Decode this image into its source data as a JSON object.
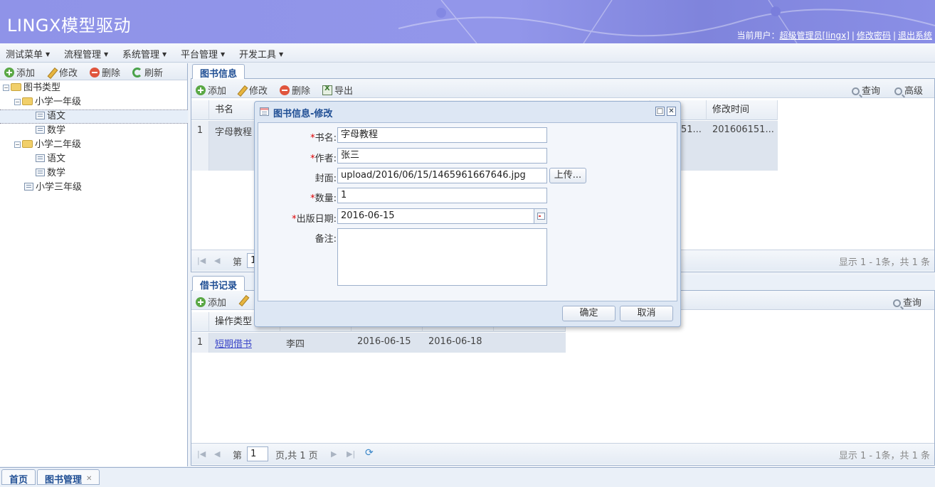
{
  "header": {
    "title": "LINGX模型驱动",
    "user_prefix": "当前用户：",
    "user_name": "超级管理员[lingx]",
    "change_password": "修改密码",
    "logout": "退出系统"
  },
  "menu": [
    "测试菜单",
    "流程管理",
    "系统管理",
    "平台管理",
    "开发工具"
  ],
  "left": {
    "toolbar": {
      "add": "添加",
      "edit": "修改",
      "delete": "删除",
      "refresh": "刷新"
    },
    "tree": {
      "root": "图书类型",
      "g1": "小学一年级",
      "g1_c1": "语文",
      "g1_c2": "数学",
      "g2": "小学二年级",
      "g2_c1": "语文",
      "g2_c2": "数学",
      "g3": "小学三年级"
    }
  },
  "books": {
    "tab": "图书信息",
    "toolbar": {
      "add": "添加",
      "edit": "修改",
      "delete": "删除",
      "export": "导出",
      "query": "查询",
      "advanced": "高级"
    },
    "columns": {
      "name": "书名",
      "modified": "修改时间"
    },
    "row": {
      "num": "1",
      "name": "字母教程",
      "created_partial": "51...",
      "modified": "201606151..."
    },
    "pager": {
      "page_label": "第",
      "page_value": "1",
      "summary": "显示 1 - 1条，共 1 条"
    }
  },
  "borrow": {
    "tab": "借书记录",
    "toolbar": {
      "add": "添加",
      "query": "查询"
    },
    "columns": {
      "op_type": "操作类型"
    },
    "row": {
      "num": "1",
      "op_type": "短期借书",
      "person": "李四",
      "date1": "2016-06-15",
      "date2": "2016-06-18"
    },
    "pager": {
      "page_label": "第",
      "page_value": "1",
      "page_total": "页,共 1 页",
      "summary": "显示 1 - 1条，共 1 条"
    }
  },
  "modal": {
    "title": "图书信息-修改",
    "fields": {
      "name_label": "书名:",
      "name_value": "字母教程",
      "author_label": "作者:",
      "author_value": "张三",
      "cover_label": "封面:",
      "cover_value": "upload/2016/06/15/1465961667646.jpg",
      "upload_label": "上传...",
      "qty_label": "数量:",
      "qty_value": "1",
      "pubdate_label": "出版日期:",
      "pubdate_value": "2016-06-15",
      "notes_label": "备注:",
      "notes_value": ""
    },
    "required_mark": "*",
    "ok": "确定",
    "cancel": "取消"
  },
  "bottom_tabs": {
    "home": "首页",
    "books": "图书管理"
  }
}
